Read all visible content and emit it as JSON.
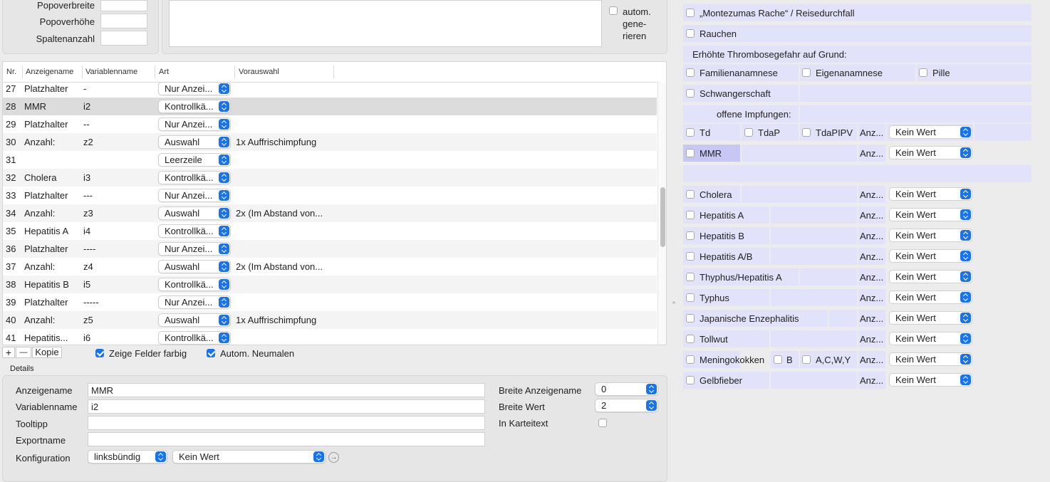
{
  "top_left": {
    "labels": [
      "Popoverbreite",
      "Popoverhöhe",
      "Spaltenanzahl"
    ],
    "autogen_label_lines": [
      "autom.",
      "gene-",
      "rieren"
    ]
  },
  "table": {
    "columns": [
      "Nr.",
      "Anzeigename",
      "Variablenname",
      "Art",
      "Vorauswahl"
    ],
    "rows": [
      {
        "nr": "27",
        "name": "Platzhalter",
        "var": "-",
        "art": "Nur Anzei...",
        "vor": ""
      },
      {
        "nr": "28",
        "name": "MMR",
        "var": "i2",
        "art": "Kontrollkä...",
        "vor": ""
      },
      {
        "nr": "29",
        "name": "Platzhalter",
        "var": "--",
        "art": "Nur Anzei...",
        "vor": ""
      },
      {
        "nr": "30",
        "name": "Anzahl:",
        "var": "z2",
        "art": "Auswahl",
        "vor": "1x Auffrischimpfung"
      },
      {
        "nr": "31",
        "name": "",
        "var": "",
        "art": "Leerzeile",
        "vor": ""
      },
      {
        "nr": "32",
        "name": "Cholera",
        "var": "i3",
        "art": "Kontrollkä...",
        "vor": ""
      },
      {
        "nr": "33",
        "name": "Platzhalter",
        "var": "---",
        "art": "Nur Anzei...",
        "vor": ""
      },
      {
        "nr": "34",
        "name": "Anzahl:",
        "var": "z3",
        "art": "Auswahl",
        "vor": "2x (Im Abstand von..."
      },
      {
        "nr": "35",
        "name": "Hepatitis A",
        "var": "i4",
        "art": "Kontrollkä...",
        "vor": ""
      },
      {
        "nr": "36",
        "name": "Platzhalter",
        "var": "----",
        "art": "Nur Anzei...",
        "vor": ""
      },
      {
        "nr": "37",
        "name": "Anzahl:",
        "var": "z4",
        "art": "Auswahl",
        "vor": "2x (Im Abstand von..."
      },
      {
        "nr": "38",
        "name": "Hepatitis B",
        "var": "i5",
        "art": "Kontrollkä...",
        "vor": ""
      },
      {
        "nr": "39",
        "name": "Platzhalter",
        "var": "-----",
        "art": "Nur Anzei...",
        "vor": ""
      },
      {
        "nr": "40",
        "name": "Anzahl:",
        "var": "z5",
        "art": "Auswahl",
        "vor": "1x Auffrischimpfung"
      },
      {
        "nr": "41",
        "name": "Hepatitis...",
        "var": "i6",
        "art": "Kontrollkä...",
        "vor": ""
      }
    ],
    "selected_row": "28"
  },
  "toolbar": {
    "add": "+",
    "remove": "—",
    "copy": "Kopie",
    "colored_fields": "Zeige Felder farbig",
    "auto_repaint": "Autom. Neumalen"
  },
  "details": {
    "title": "Details",
    "labels": {
      "display_name": "Anzeigename",
      "var_name": "Variablenname",
      "tooltip": "Tooltipp",
      "export_name": "Exportname",
      "config": "Konfiguration",
      "width_display": "Breite Anzeigename",
      "width_value": "Breite Wert",
      "in_karteitext": "In Karteitext"
    },
    "values": {
      "display_name": "MMR",
      "var_name": "i2",
      "tooltip": "",
      "export_name": "",
      "alignment": "linksbündig",
      "config_value": "Kein Wert",
      "width_display": "0",
      "width_value": "2"
    }
  },
  "preview": {
    "montezuma": "„Montezumas Rache“ / Reisedurchfall",
    "smoking": "Rauchen",
    "thrombosis": "Erhöhte Thrombosegefahr auf Grund:",
    "family": "Familienanamnese",
    "own": "Eigenanamnese",
    "pill": "Pille",
    "pregnancy": "Schwangerschaft",
    "open_vacc": "offene Impfungen:",
    "td": "Td",
    "tdap": "TdaP",
    "tdapipv": "TdaPIPV",
    "anz": "Anz...",
    "no_value": "Kein Wert",
    "mmr": "MMR",
    "vaccines": [
      "Cholera",
      "Hepatitis A",
      "Hepatitis B",
      "Hepatitis A/B",
      "Thyphus/Hepatitis A",
      "Typhus",
      "Japanische Enzephalitis",
      "Tollwut",
      "Meningokokken",
      "Gelbfieber"
    ],
    "mening_b": "B",
    "mening_acwy": "A,C,W,Y"
  },
  "colors": {
    "accent": "#1a73e8",
    "cell_lavender": "#e3e2fb",
    "mmr_highlight": "#c8c6f5"
  }
}
